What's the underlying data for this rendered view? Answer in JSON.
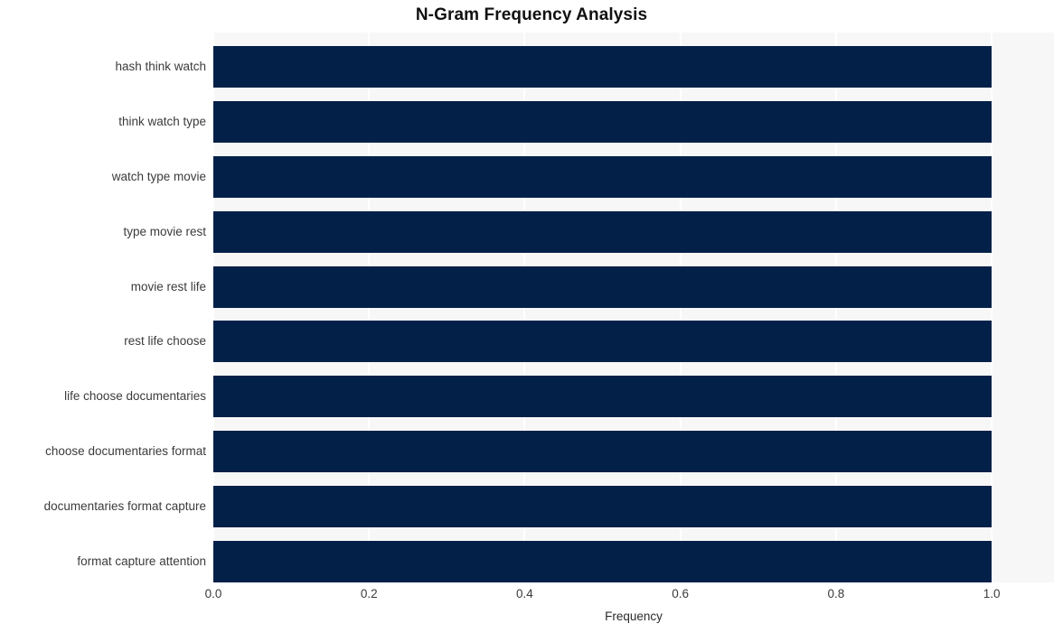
{
  "chart_data": {
    "type": "bar",
    "orientation": "horizontal",
    "title": "N-Gram Frequency Analysis",
    "xlabel": "Frequency",
    "ylabel": "",
    "categories": [
      "hash think watch",
      "think watch type",
      "watch type movie",
      "type movie rest",
      "movie rest life",
      "rest life choose",
      "life choose documentaries",
      "choose documentaries format",
      "documentaries format capture",
      "format capture attention"
    ],
    "values": [
      1.0,
      1.0,
      1.0,
      1.0,
      1.0,
      1.0,
      1.0,
      1.0,
      1.0,
      1.0
    ],
    "xlim": [
      0.0,
      1.08
    ],
    "xticks": [
      "0.0",
      "0.2",
      "0.4",
      "0.6",
      "0.8",
      "1.0"
    ],
    "xtick_values": [
      0.0,
      0.2,
      0.4,
      0.6,
      0.8,
      1.0
    ],
    "grid": "vertical-white",
    "legend": "none",
    "bar_color": "#032048",
    "plot_background": "#f7f7f7",
    "figure_background": "#ffffff"
  }
}
